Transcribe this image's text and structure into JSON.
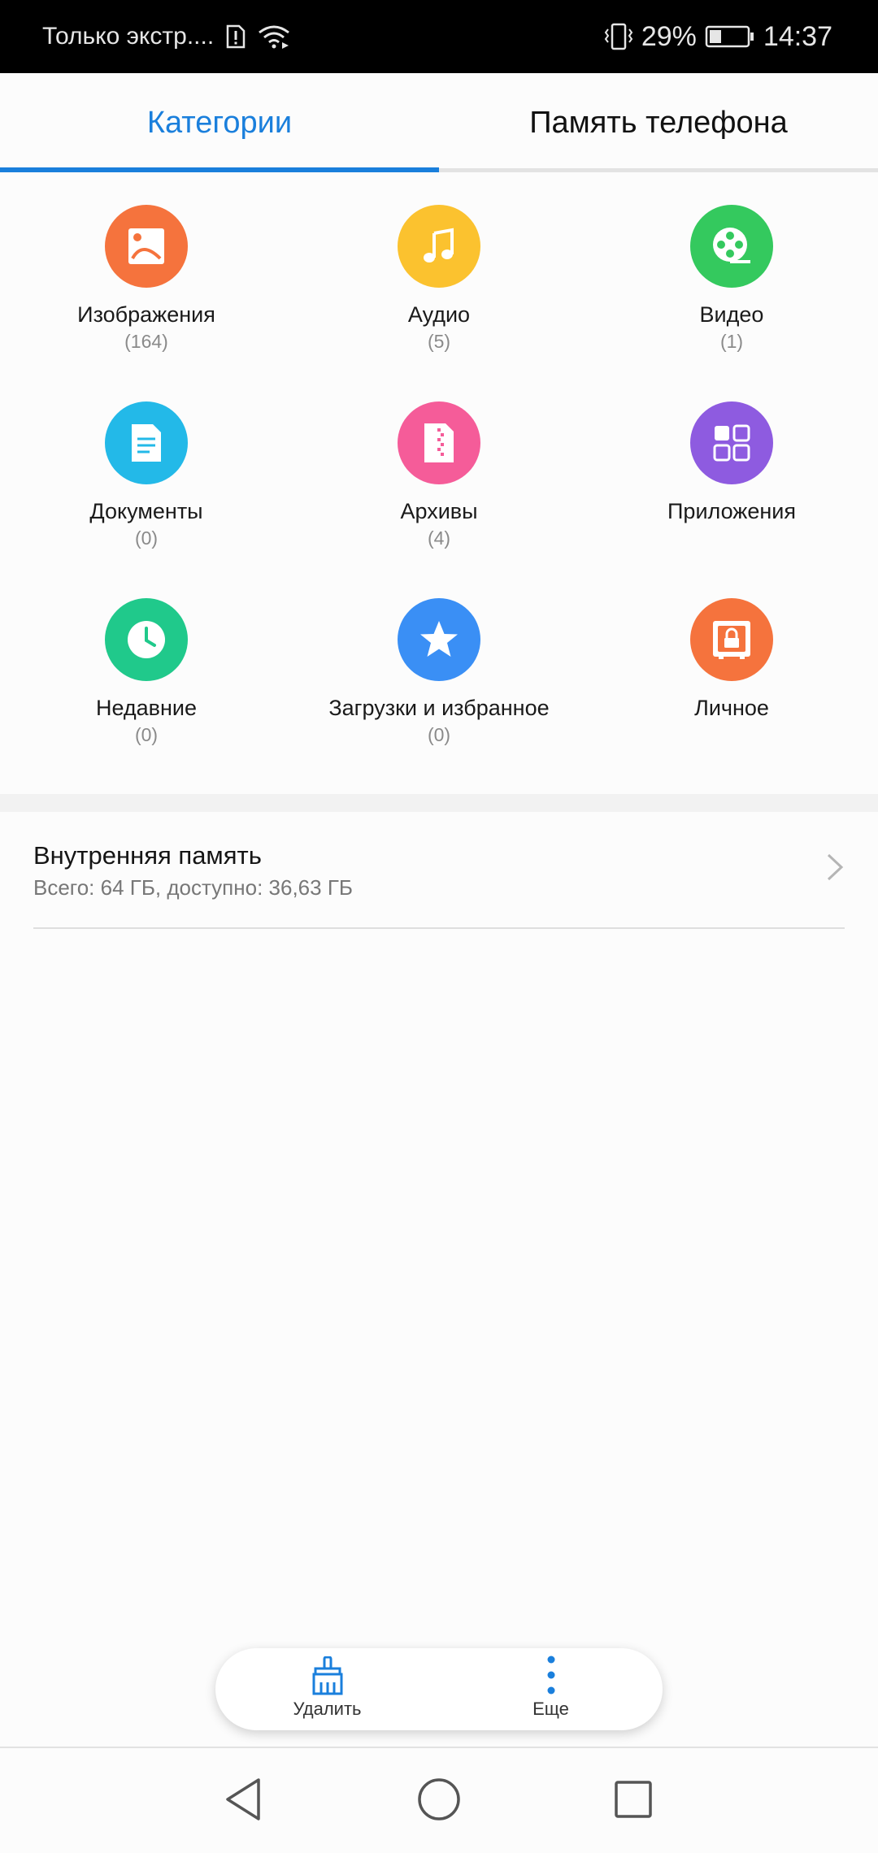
{
  "status_bar": {
    "carrier": "Только экстр....",
    "battery": "29%",
    "time": "14:37"
  },
  "tabs": [
    {
      "label": "Категории",
      "active": true
    },
    {
      "label": "Память телефона",
      "active": false
    }
  ],
  "categories": [
    {
      "label": "Изображения",
      "count": "(164)",
      "icon": "image-icon",
      "color": "#f5733d"
    },
    {
      "label": "Аудио",
      "count": "(5)",
      "icon": "music-note-icon",
      "color": "#fbc22f"
    },
    {
      "label": "Видео",
      "count": "(1)",
      "icon": "film-reel-icon",
      "color": "#34c95e"
    },
    {
      "label": "Документы",
      "count": "(0)",
      "icon": "document-icon",
      "color": "#23b9e8"
    },
    {
      "label": "Архивы",
      "count": "(4)",
      "icon": "archive-icon",
      "color": "#f55c99"
    },
    {
      "label": "Приложения",
      "count": "",
      "icon": "apps-grid-icon",
      "color": "#8e5be0"
    },
    {
      "label": "Недавние",
      "count": "(0)",
      "icon": "clock-icon",
      "color": "#20c98b"
    },
    {
      "label": "Загрузки и избранное",
      "count": "(0)",
      "icon": "star-icon",
      "color": "#3a8ff5"
    },
    {
      "label": "Личное",
      "count": "",
      "icon": "safe-icon",
      "color": "#f5733d"
    }
  ],
  "storage": {
    "title": "Внутренняя память",
    "subtitle": "Всего: 64 ГБ, доступно: 36,63 ГБ"
  },
  "actions": {
    "delete_label": "Удалить",
    "more_label": "Еще"
  },
  "colors": {
    "accent": "#1a7fdc"
  }
}
